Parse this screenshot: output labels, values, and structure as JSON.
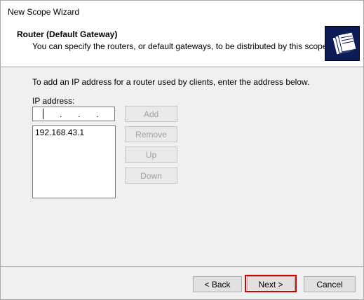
{
  "window": {
    "title": "New Scope Wizard"
  },
  "header": {
    "title": "Router (Default Gateway)",
    "subtitle": "You can specify the routers, or default gateways, to be distributed by this scope.",
    "icon": "folders-icon"
  },
  "body": {
    "instruction": "To add an IP address for a router used by clients, enter the address below.",
    "ip_label": "IP address:",
    "ip_input": {
      "value": "",
      "separators": [
        ".",
        ".",
        "."
      ]
    },
    "router_list": [
      "192.168.43.1"
    ]
  },
  "side_buttons": {
    "add": "Add",
    "remove": "Remove",
    "up": "Up",
    "down": "Down"
  },
  "footer": {
    "back": "< Back",
    "next": "Next >",
    "cancel": "Cancel",
    "highlight_color": "#d00000"
  }
}
